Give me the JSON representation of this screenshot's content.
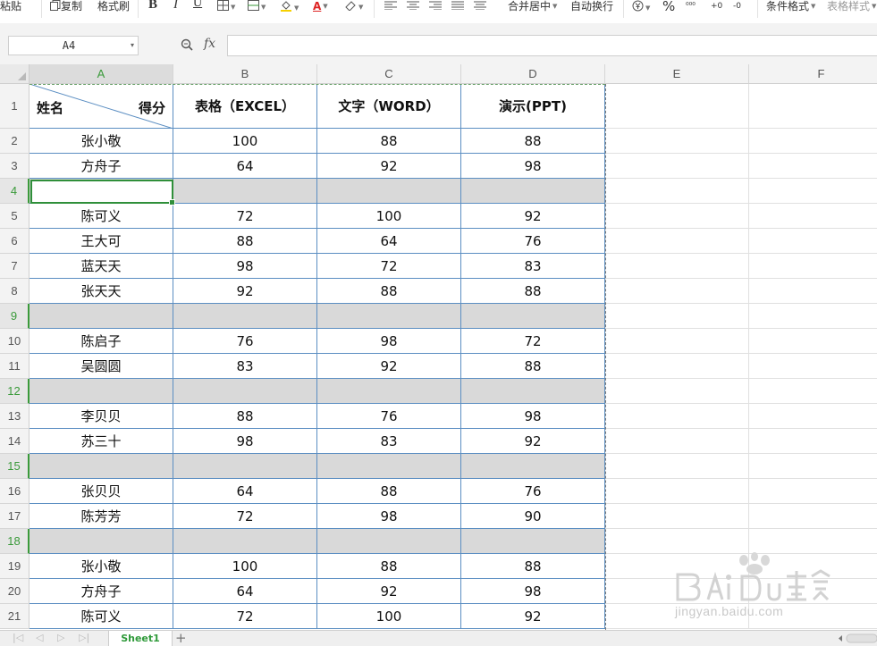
{
  "toolbar": {
    "paste": "粘贴",
    "copy": "复制",
    "format_painter": "格式刷",
    "bold": "B",
    "italic": "I",
    "underline": "U",
    "font_color": "A",
    "merge_center": "合并居中",
    "wrap_text": "自动换行",
    "percent": "%",
    "conditional_format": "条件格式",
    "table_style": "表格样式"
  },
  "formula_bar": {
    "name_box": "A4",
    "fx": "fx",
    "formula_value": ""
  },
  "columns": [
    "A",
    "B",
    "C",
    "D",
    "E",
    "F"
  ],
  "selected_column": "A",
  "header_row": {
    "diag_left": "姓名",
    "diag_right": "得分",
    "excel": "表格（EXCEL）",
    "word": "文字（WORD）",
    "ppt": "演示(PPT)"
  },
  "rows": [
    {
      "n": "1"
    },
    {
      "n": "2",
      "name": "张小敬",
      "b": "100",
      "c": "88",
      "d": "88"
    },
    {
      "n": "3",
      "name": "方舟子",
      "b": "64",
      "c": "92",
      "d": "98"
    },
    {
      "n": "4",
      "blank": true
    },
    {
      "n": "5",
      "name": "陈可义",
      "b": "72",
      "c": "100",
      "d": "92"
    },
    {
      "n": "6",
      "name": "王大可",
      "b": "88",
      "c": "64",
      "d": "76"
    },
    {
      "n": "7",
      "name": "蓝天天",
      "b": "98",
      "c": "72",
      "d": "83"
    },
    {
      "n": "8",
      "name": "张天天",
      "b": "92",
      "c": "88",
      "d": "88"
    },
    {
      "n": "9",
      "blank": true
    },
    {
      "n": "10",
      "name": "陈启子",
      "b": "76",
      "c": "98",
      "d": "72"
    },
    {
      "n": "11",
      "name": "吴圆圆",
      "b": "83",
      "c": "92",
      "d": "88"
    },
    {
      "n": "12",
      "blank": true
    },
    {
      "n": "13",
      "name": "李贝贝",
      "b": "88",
      "c": "76",
      "d": "98"
    },
    {
      "n": "14",
      "name": "苏三十",
      "b": "98",
      "c": "83",
      "d": "92"
    },
    {
      "n": "15",
      "blank": true
    },
    {
      "n": "16",
      "name": "张贝贝",
      "b": "64",
      "c": "88",
      "d": "76"
    },
    {
      "n": "17",
      "name": "陈芳芳",
      "b": "72",
      "c": "98",
      "d": "90"
    },
    {
      "n": "18",
      "blank": true
    },
    {
      "n": "19",
      "name": "张小敬",
      "b": "100",
      "c": "88",
      "d": "88"
    },
    {
      "n": "20",
      "name": "方舟子",
      "b": "64",
      "c": "92",
      "d": "98"
    },
    {
      "n": "21",
      "name": "陈可义",
      "b": "72",
      "c": "100",
      "d": "92"
    }
  ],
  "sheet_tabs": [
    "Sheet1"
  ],
  "active_sheet": "Sheet1",
  "watermark": {
    "logo": "Baidu经验",
    "url": "jingyan.baidu.com"
  },
  "colors": {
    "selection_green": "#2f8f3a",
    "table_border_blue": "#5b8ec2",
    "blank_row_gray": "#d9d9d9"
  }
}
